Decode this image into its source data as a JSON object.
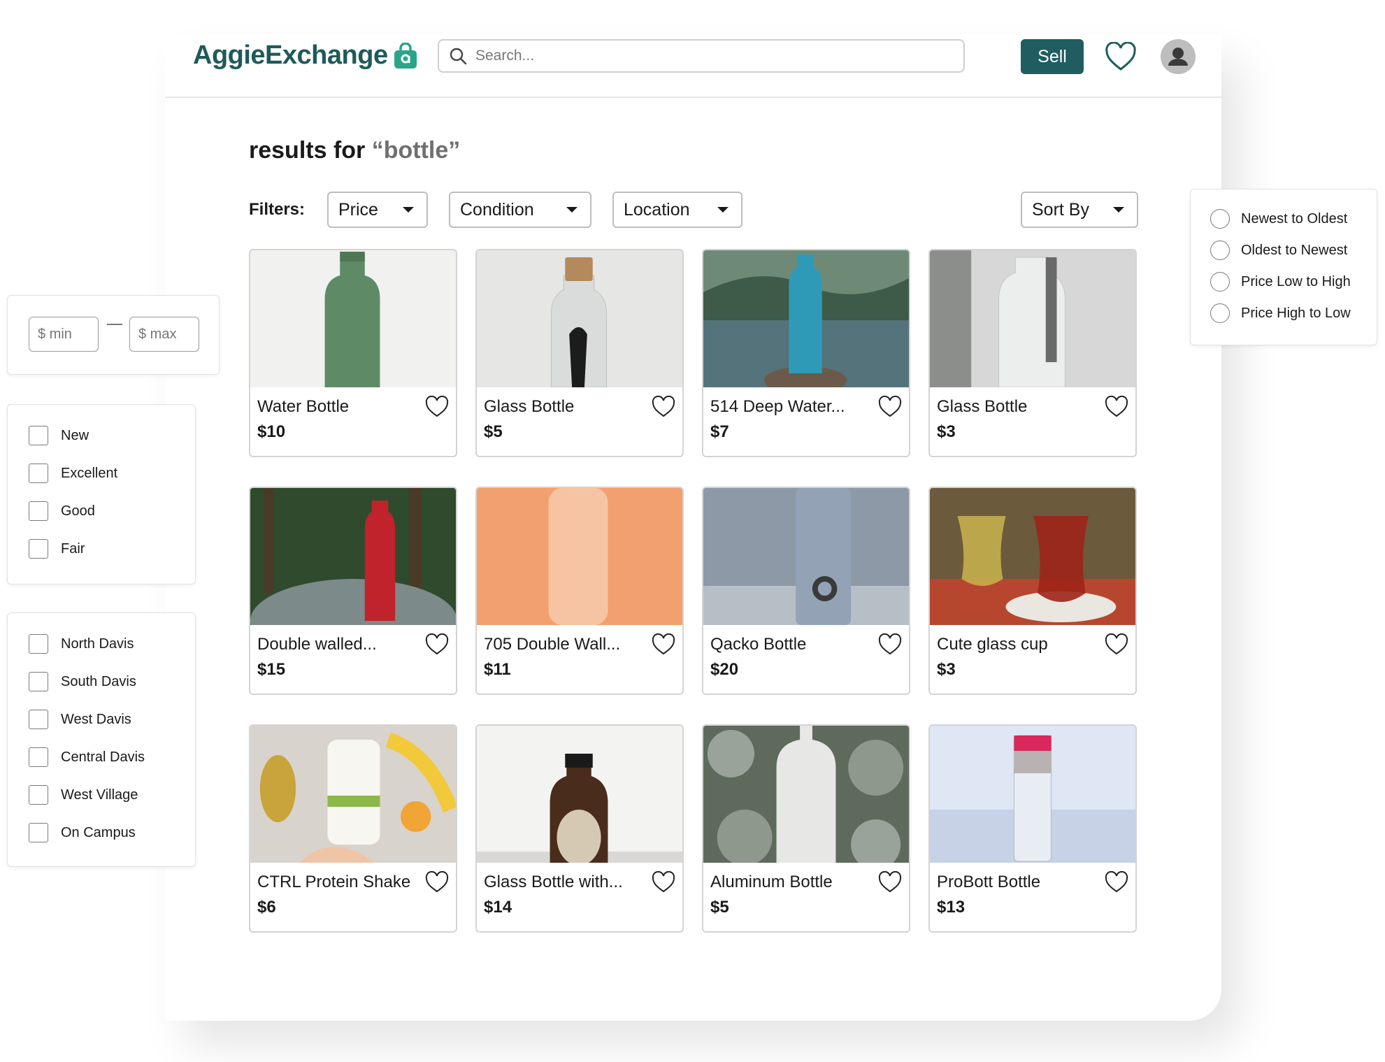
{
  "app": {
    "name": "AggieExchange"
  },
  "search": {
    "placeholder": "Search..."
  },
  "header": {
    "sell_label": "Sell"
  },
  "results": {
    "prefix": "results for ",
    "query": "“bottle”"
  },
  "filters": {
    "label": "Filters:",
    "price": "Price",
    "condition": "Condition",
    "location": "Location",
    "sort": "Sort By"
  },
  "price_range": {
    "min_placeholder": "$ min",
    "max_placeholder": "$ max"
  },
  "condition_options": [
    "New",
    "Excellent",
    "Good",
    "Fair"
  ],
  "location_options": [
    "North Davis",
    "South Davis",
    "West Davis",
    "Central Davis",
    "West Village",
    "On Campus"
  ],
  "sort_options": [
    "Newest to Oldest",
    "Oldest to Newest",
    "Price Low to High",
    "Price High to Low"
  ],
  "products": [
    {
      "title": "Water Bottle",
      "price": "$10"
    },
    {
      "title": "Glass Bottle",
      "price": "$5"
    },
    {
      "title": "514 Deep Water...",
      "price": "$7"
    },
    {
      "title": "Glass Bottle",
      "price": "$3"
    },
    {
      "title": "Double walled...",
      "price": "$15"
    },
    {
      "title": "705 Double Wall...",
      "price": "$11"
    },
    {
      "title": "Qacko Bottle",
      "price": "$20"
    },
    {
      "title": "Cute glass cup",
      "price": "$3"
    },
    {
      "title": "CTRL Protein Shake",
      "price": "$6"
    },
    {
      "title": "Glass Bottle with...",
      "price": "$14"
    },
    {
      "title": "Aluminum Bottle",
      "price": "$5"
    },
    {
      "title": "ProBott Bottle",
      "price": "$13"
    }
  ],
  "colors": {
    "brand": "#1f5d61",
    "logo": "#1e5a5a"
  }
}
